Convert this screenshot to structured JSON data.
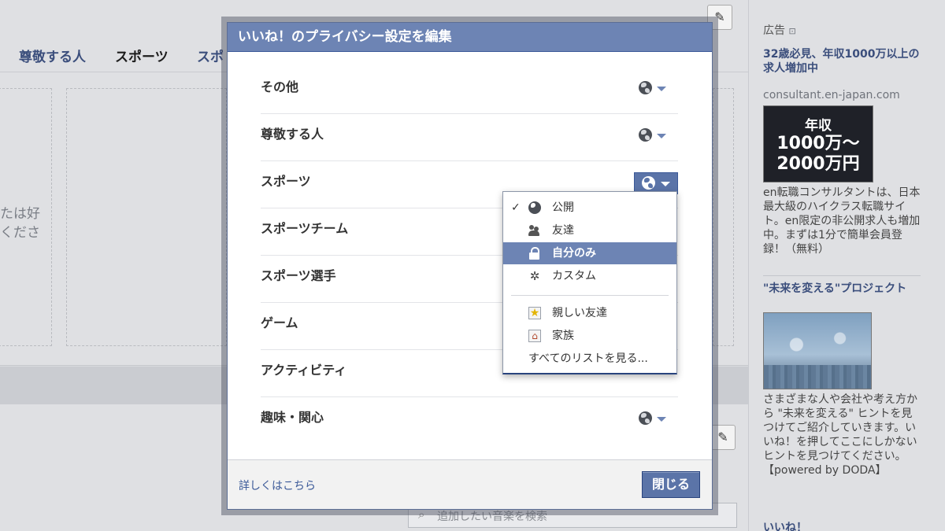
{
  "background": {
    "tabs": [
      "尊敬する人",
      "スポーツ",
      "スポ"
    ],
    "selected_tab": "スポーツ",
    "cut_text_line1": "たは好",
    "cut_text_line2": "くださ",
    "search_placeholder": "追加したい音楽を検索"
  },
  "dialog": {
    "title": "いいね！のプライバシー設定を編集",
    "rows": [
      {
        "label": "その他"
      },
      {
        "label": "尊敬する人"
      },
      {
        "label": "スポーツ"
      },
      {
        "label": "スポーツチーム"
      },
      {
        "label": "スポーツ選手"
      },
      {
        "label": "ゲーム"
      },
      {
        "label": "アクティビティ"
      },
      {
        "label": "趣味・関心"
      }
    ],
    "menu": {
      "checkmark": "✓",
      "items": [
        {
          "label": "公開",
          "icon": "globe-icon",
          "checked": true
        },
        {
          "label": "友達",
          "icon": "friends-icon"
        },
        {
          "label": "自分のみ",
          "icon": "lock-icon",
          "highlighted": true
        },
        {
          "label": "カスタム",
          "icon": "gear-icon"
        },
        {
          "label": "親しい友達",
          "icon": "star-icon"
        },
        {
          "label": "家族",
          "icon": "home-icon"
        },
        {
          "label": "すべてのリストを見る..."
        }
      ]
    },
    "footer": {
      "more_link": "詳しくはこちら",
      "close_label": "閉じる"
    }
  },
  "ads": {
    "header": "広告",
    "ad1": {
      "title": "32歳必見、年収1000万以上の求人増加中",
      "url": "consultant.en-japan.com",
      "image_line1": "年収",
      "image_line2": "1000万～",
      "image_line3": "2000万円",
      "body": "en転職コンサルタントは、日本最大級のハイクラス転職サイト。en限定の非公開求人も増加中。まずは1分で簡単会員登録！（無料）"
    },
    "ad2": {
      "title": "\"未来を変える\"プロジェクト",
      "body": "さまざまな人や会社や考え方から \"未来を変える\" ヒントを見つけてご紹介していきます。いいね！を押してここにしかないヒントを見つけてください。【powered by DODA】",
      "like": "いいね！"
    }
  },
  "colors": {
    "header_blue": "#6d84b4",
    "button_blue": "#5b74a8",
    "link_blue": "#3b5998"
  }
}
